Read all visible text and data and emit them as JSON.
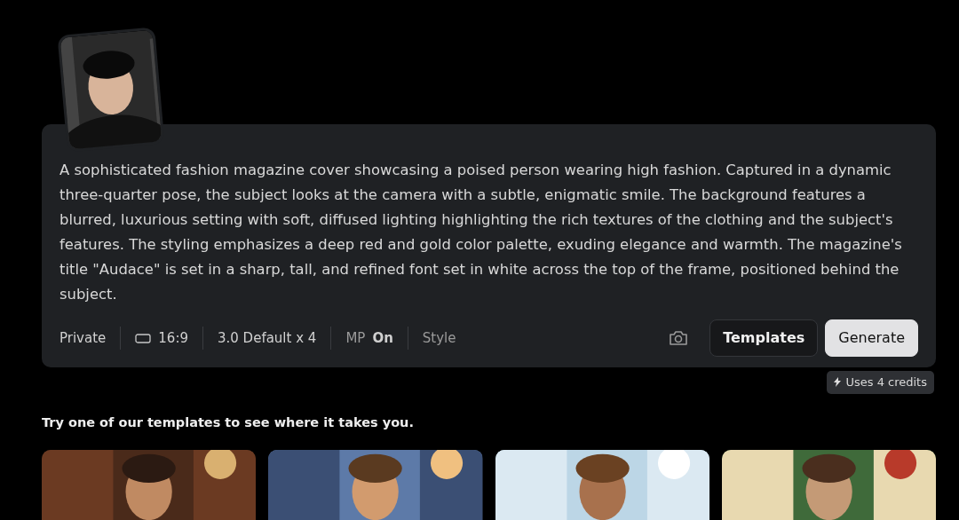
{
  "prompt": {
    "value": "A sophisticated fashion magazine cover showcasing a poised person wearing high fashion. Captured in a dynamic three-quarter pose, the subject looks at the camera with a subtle, enigmatic smile. The background features a blurred, luxurious setting with soft, diffused lighting highlighting the rich textures of the clothing and the subject's features. The styling emphasizes a deep red and gold color palette, exuding elegance and warmth. The magazine's title \"Audace\" is set in a sharp, tall, and refined font set in white across the top of the frame, positioned behind the subject."
  },
  "options": [
    {
      "kind": "text",
      "label": "Private"
    },
    {
      "kind": "ratio",
      "label": "16:9"
    },
    {
      "kind": "text",
      "label": "3.0 Default x 4"
    },
    {
      "kind": "pair",
      "label": "MP",
      "value": "On"
    },
    {
      "kind": "dim",
      "label": "Style"
    }
  ],
  "buttons": [
    {
      "kind": "outline",
      "label": "Templates"
    },
    {
      "kind": "primary",
      "label": "Generate"
    }
  ],
  "tooltip": "Uses 4 credits",
  "templates": {
    "heading": "Try one of our templates to see where it takes you."
  }
}
